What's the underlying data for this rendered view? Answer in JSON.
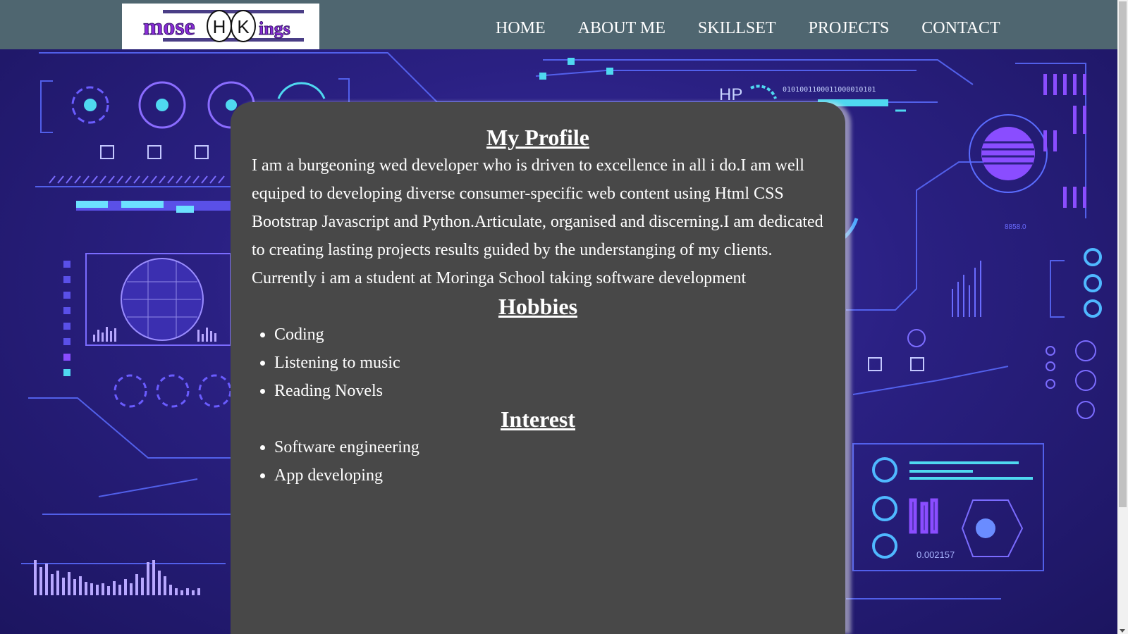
{
  "navbar": {
    "logo": {
      "part1": "mose",
      "circle1": "H",
      "circle2": "K",
      "part2": "ings"
    },
    "links": [
      "HOME",
      "ABOUT ME",
      "SKILLSET",
      "PROJECTS",
      "CONTACT"
    ]
  },
  "background": {
    "hud_label": "HP",
    "binary_text": "0101001100011000010101",
    "small_number": "8858.0",
    "readout": "0.002157"
  },
  "profile": {
    "title": "My Profile",
    "text": "I am a burgeoning wed developer who is driven to excellence in all i do.I am well equiped to developing diverse consumer-specific web content using Html CSS Bootstrap Javascript and Python.Articulate, organised and discerning.I am dedicated to creating lasting projects results guided by the understanging of my clients. Currently i am a student at Moringa School taking software development"
  },
  "hobbies": {
    "title": "Hobbies",
    "items": [
      "Coding",
      "Listening to music",
      "Reading Novels"
    ]
  },
  "interest": {
    "title": "Interest",
    "items": [
      "Software engineering",
      "App developing"
    ]
  },
  "colors": {
    "navbar": "#4f6670",
    "card": "#484848",
    "background": "#2a2082",
    "accent_cyan": "#4fd8f0",
    "accent_purple": "#8a4dff"
  }
}
